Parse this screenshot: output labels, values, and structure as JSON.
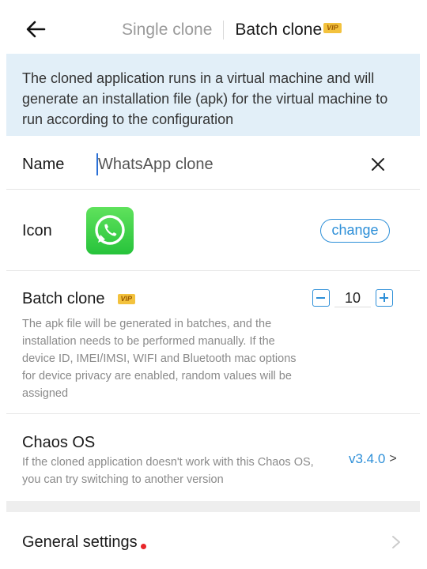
{
  "header": {
    "tabs": [
      {
        "label": "Single clone",
        "active": false
      },
      {
        "label": "Batch clone",
        "active": true
      }
    ],
    "vip_badge": "VIP"
  },
  "notice": {
    "text": "The cloned application runs in a virtual machine and will generate an installation file (apk) for the virtual machine to run according to the configuration"
  },
  "name": {
    "label": "Name",
    "value": "WhatsApp clone"
  },
  "icon": {
    "label": "Icon",
    "app_icon": "whatsapp-icon",
    "change_label": "change"
  },
  "batch": {
    "title": "Batch clone",
    "vip_badge": "VIP",
    "description": "The apk file will be generated in batches, and the installation needs to be performed manually. If the device ID, IMEI/IMSI, WIFI and Bluetooth mac options for device privacy are enabled, random values will be assigned",
    "count": "10"
  },
  "chaos": {
    "title": "Chaos OS",
    "description": "If the cloned application doesn't work with this Chaos OS, you can try switching to another version",
    "version": "v3.4.0",
    "chevron": ">"
  },
  "general": {
    "label": "General settings",
    "has_notification_dot": true
  },
  "colors": {
    "accent": "#2d8fd8",
    "notice_bg": "#e2eff8",
    "vip_bg": "#f3c23d",
    "whatsapp_green": "#27c33b",
    "notification_dot": "#e8262a"
  }
}
